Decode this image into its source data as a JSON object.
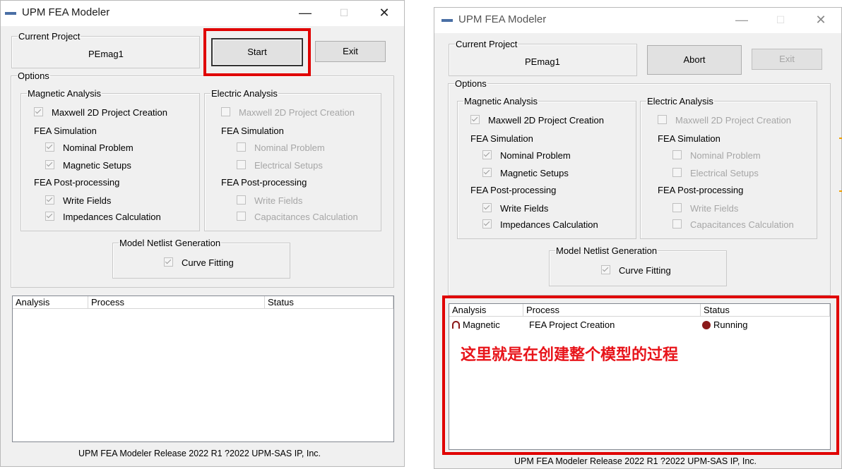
{
  "app": {
    "title": "UPM FEA Modeler",
    "minimize_glyph": "—",
    "maximize_glyph": "☐",
    "close_glyph": "✕",
    "footer": "UPM FEA Modeler Release 2022 R1 ?2022 UPM-SAS IP, Inc."
  },
  "project": {
    "legend": "Current Project",
    "name": "PEmag1"
  },
  "buttons": {
    "start": "Start",
    "exit": "Exit",
    "abort": "Abort"
  },
  "options": {
    "legend": "Options",
    "magnetic": {
      "legend": "Magnetic Analysis",
      "maxwell": "Maxwell 2D Project Creation",
      "fea_simulation": "FEA Simulation",
      "nominal": "Nominal Problem",
      "setups": "Magnetic Setups",
      "post": "FEA Post-processing",
      "write_fields": "Write Fields",
      "impedances": "Impedances Calculation"
    },
    "electric": {
      "legend": "Electric Analysis",
      "maxwell": "Maxwell 2D Project Creation",
      "fea_simulation": "FEA Simulation",
      "nominal": "Nominal Problem",
      "setups": "Electrical Setups",
      "post": "FEA Post-processing",
      "write_fields": "Write Fields",
      "capacitances": "Capacitances Calculation"
    },
    "netlist": {
      "legend": "Model Netlist Generation",
      "curve_fitting": "Curve Fitting"
    }
  },
  "list": {
    "columns": [
      "Analysis",
      "Process",
      "Status"
    ],
    "rows": [
      {
        "analysis": "Magnetic",
        "process": "FEA Project Creation",
        "status": "Running"
      }
    ]
  },
  "annotation": "这里就是在创建整个模型的过程",
  "colors": {
    "highlight": "#e00000",
    "status_icon": "#8b1a1a"
  },
  "icons": {
    "app": "app-icon",
    "magnetic": "magnet-icon",
    "running": "running-status-icon"
  }
}
